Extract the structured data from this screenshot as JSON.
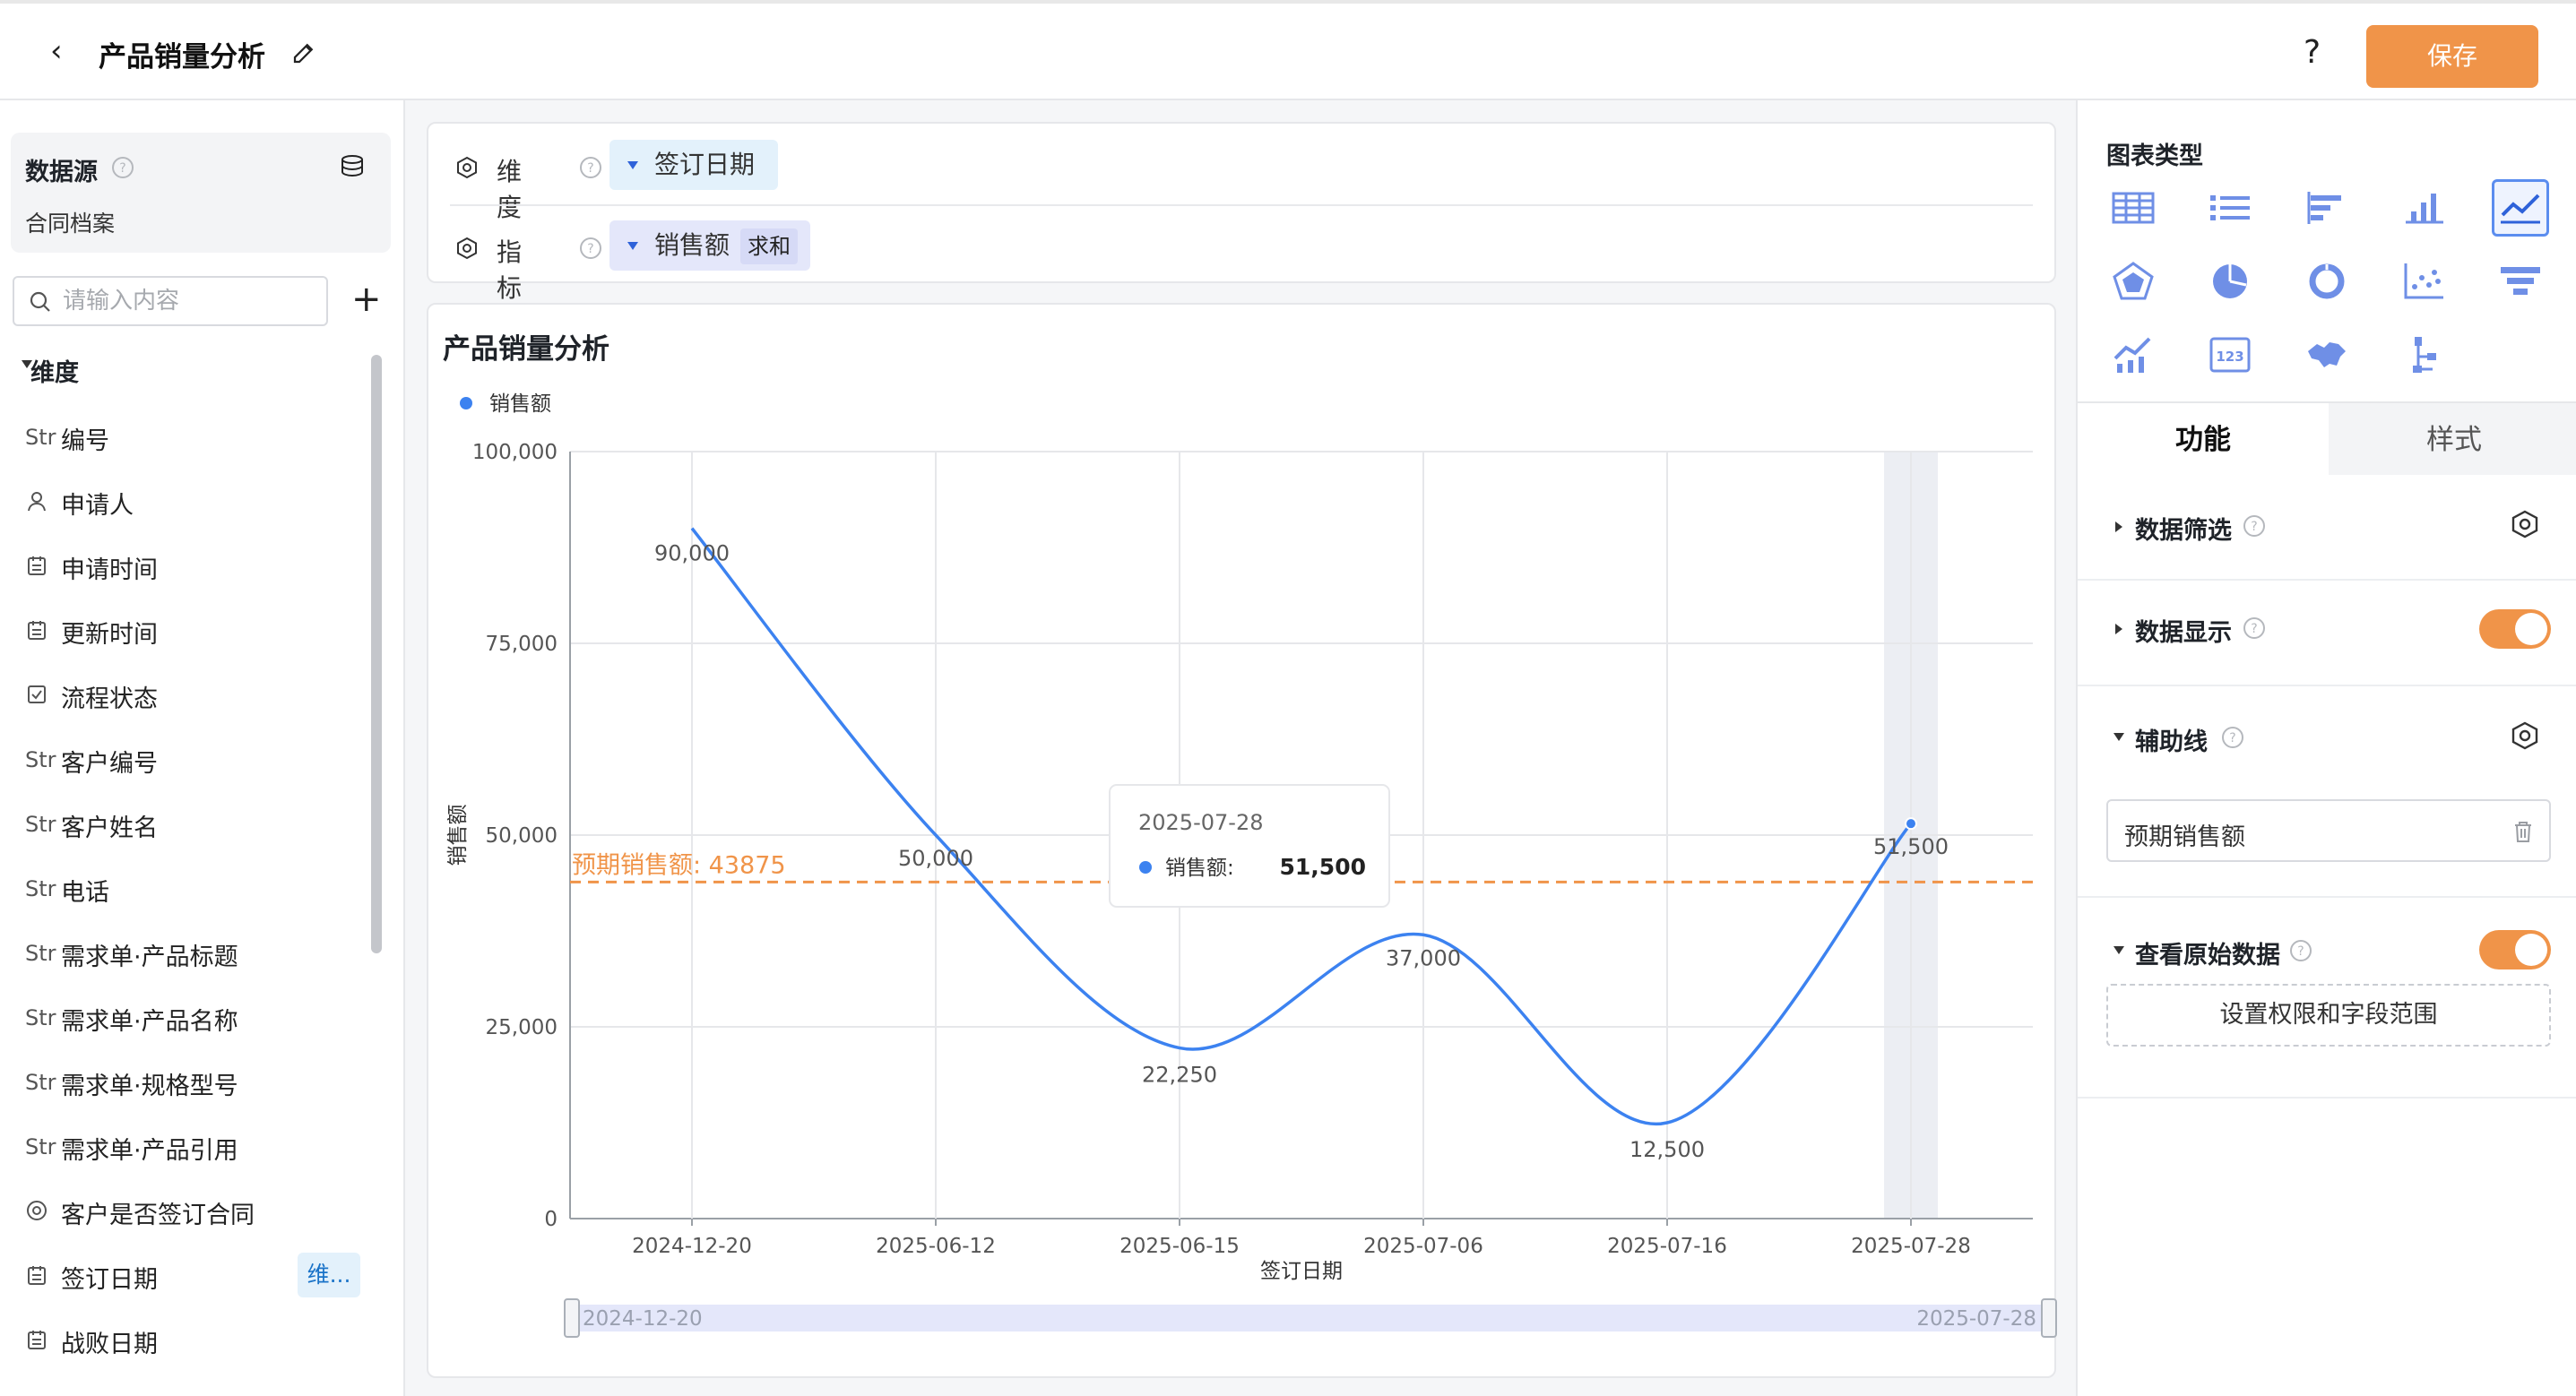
{
  "header": {
    "title": "产品销量分析",
    "help": "?",
    "save_label": "保存"
  },
  "datasource": {
    "title": "数据源",
    "name": "合同档案"
  },
  "search": {
    "placeholder": "请输入内容"
  },
  "dimensions": {
    "heading": "维度",
    "fields": [
      {
        "icon": "Str",
        "label": "编号"
      },
      {
        "icon": "person-icon",
        "label": "申请人"
      },
      {
        "icon": "calendar-icon",
        "label": "申请时间"
      },
      {
        "icon": "calendar-icon",
        "label": "更新时间"
      },
      {
        "icon": "checkbox-icon",
        "label": "流程状态"
      },
      {
        "icon": "Str",
        "label": "客户编号"
      },
      {
        "icon": "Str",
        "label": "客户姓名"
      },
      {
        "icon": "Str",
        "label": "电话"
      },
      {
        "icon": "Str",
        "label": "需求单·产品标题"
      },
      {
        "icon": "Str",
        "label": "需求单·产品名称"
      },
      {
        "icon": "Str",
        "label": "需求单·规格型号"
      },
      {
        "icon": "Str",
        "label": "需求单·产品引用"
      },
      {
        "icon": "radio-icon",
        "label": "客户是否签订合同"
      },
      {
        "icon": "calendar-icon",
        "label": "签订日期",
        "tag": "维..."
      },
      {
        "icon": "calendar-icon",
        "label": "战败日期"
      }
    ]
  },
  "config": {
    "dimension_label": "维度",
    "dimension_value": "签订日期",
    "metric_label": "指标",
    "metric_value": "销售额",
    "metric_agg": "求和"
  },
  "chart_card": {
    "title": "产品销量分析"
  },
  "chart_data": {
    "type": "line",
    "title": "产品销量分析",
    "xlabel": "签订日期",
    "ylabel": "销售额",
    "categories": [
      "2024-12-20",
      "2025-06-12",
      "2025-06-15",
      "2025-07-06",
      "2025-07-16",
      "2025-07-28"
    ],
    "series": [
      {
        "name": "销售额",
        "values": [
          90000,
          50000,
          22250,
          37000,
          12500,
          51500
        ],
        "color": "#3c82f0"
      }
    ],
    "value_labels": [
      "90,000",
      "50,000",
      "22,250",
      "37,000",
      "12,500",
      "51,500"
    ],
    "ylim": [
      0,
      100000
    ],
    "yticks": [
      0,
      25000,
      50000,
      75000,
      100000
    ],
    "ytick_labels": [
      "0",
      "25,000",
      "50,000",
      "75,000",
      "100,000"
    ],
    "grid": true,
    "legend": "top-left",
    "reference_line": {
      "label": "预期销售额: 43875",
      "value": 43875,
      "color": "#f09449"
    },
    "tooltip": {
      "date": "2025-07-28",
      "series": "销售额:",
      "value": "51,500"
    },
    "zoom_range": {
      "start": "2024-12-20",
      "end": "2025-07-28"
    }
  },
  "right_panel": {
    "chart_type_title": "图表类型",
    "tab_function": "功能",
    "tab_style": "样式",
    "data_filter": "数据筛选",
    "data_display": "数据显示",
    "aux_line": "辅助线",
    "aux_line_value": "预期销售额",
    "view_raw": "查看原始数据",
    "permission_button": "设置权限和字段范围"
  },
  "colors": {
    "accent": "#f09449",
    "series": "#3c82f0",
    "icon": "#6f8fe6"
  }
}
